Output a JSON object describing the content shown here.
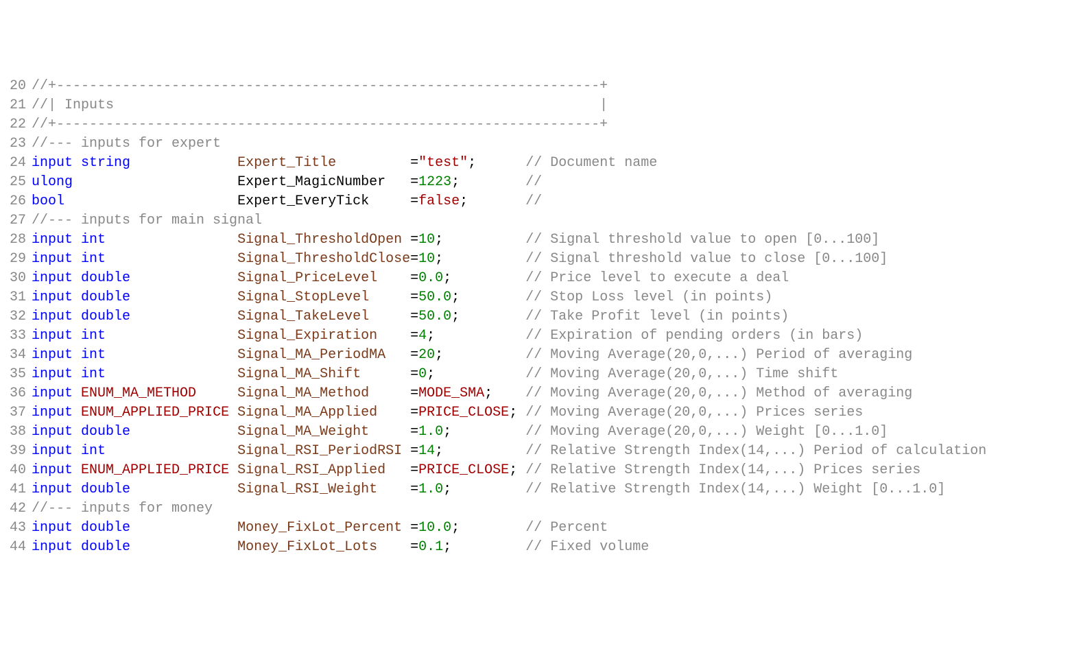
{
  "gutter": {
    "start": 20,
    "end": 44
  },
  "lines": [
    [
      {
        "cls": "tok-comment",
        "text": "//+------------------------------------------------------------------+"
      }
    ],
    [
      {
        "cls": "tok-comment",
        "text": "//| Inputs                                                           |"
      }
    ],
    [
      {
        "cls": "tok-comment",
        "text": "//+------------------------------------------------------------------+"
      }
    ],
    [
      {
        "cls": "tok-comment",
        "text": "//--- inputs for expert"
      }
    ],
    [
      {
        "cls": "tok-keyword",
        "text": "input"
      },
      {
        "cls": "tok-plain",
        "text": " "
      },
      {
        "cls": "tok-keyword",
        "text": "string"
      },
      {
        "cls": "tok-plain",
        "text": "             "
      },
      {
        "cls": "tok-name",
        "text": "Expert_Title"
      },
      {
        "cls": "tok-plain",
        "text": "         ="
      },
      {
        "cls": "tok-string",
        "text": "\"test\""
      },
      {
        "cls": "tok-punct",
        "text": ";"
      },
      {
        "cls": "tok-plain",
        "text": "      "
      },
      {
        "cls": "tok-comment",
        "text": "// Document name"
      }
    ],
    [
      {
        "cls": "tok-keyword",
        "text": "ulong"
      },
      {
        "cls": "tok-plain",
        "text": "                    "
      },
      {
        "cls": "tok-plain",
        "text": "Expert_MagicNumber"
      },
      {
        "cls": "tok-plain",
        "text": "   ="
      },
      {
        "cls": "tok-number",
        "text": "1223"
      },
      {
        "cls": "tok-punct",
        "text": ";"
      },
      {
        "cls": "tok-plain",
        "text": "        "
      },
      {
        "cls": "tok-comment",
        "text": "//"
      }
    ],
    [
      {
        "cls": "tok-keyword",
        "text": "bool"
      },
      {
        "cls": "tok-plain",
        "text": "                     "
      },
      {
        "cls": "tok-plain",
        "text": "Expert_EveryTick"
      },
      {
        "cls": "tok-plain",
        "text": "     ="
      },
      {
        "cls": "tok-const",
        "text": "false"
      },
      {
        "cls": "tok-punct",
        "text": ";"
      },
      {
        "cls": "tok-plain",
        "text": "       "
      },
      {
        "cls": "tok-comment",
        "text": "//"
      }
    ],
    [
      {
        "cls": "tok-comment",
        "text": "//--- inputs for main signal"
      }
    ],
    [
      {
        "cls": "tok-keyword",
        "text": "input"
      },
      {
        "cls": "tok-plain",
        "text": " "
      },
      {
        "cls": "tok-keyword",
        "text": "int"
      },
      {
        "cls": "tok-plain",
        "text": "                "
      },
      {
        "cls": "tok-name",
        "text": "Signal_ThresholdOpen"
      },
      {
        "cls": "tok-plain",
        "text": " ="
      },
      {
        "cls": "tok-number",
        "text": "10"
      },
      {
        "cls": "tok-punct",
        "text": ";"
      },
      {
        "cls": "tok-plain",
        "text": "          "
      },
      {
        "cls": "tok-comment",
        "text": "// Signal threshold value to open [0...100]"
      }
    ],
    [
      {
        "cls": "tok-keyword",
        "text": "input"
      },
      {
        "cls": "tok-plain",
        "text": " "
      },
      {
        "cls": "tok-keyword",
        "text": "int"
      },
      {
        "cls": "tok-plain",
        "text": "                "
      },
      {
        "cls": "tok-name",
        "text": "Signal_ThresholdClose"
      },
      {
        "cls": "tok-plain",
        "text": "="
      },
      {
        "cls": "tok-number",
        "text": "10"
      },
      {
        "cls": "tok-punct",
        "text": ";"
      },
      {
        "cls": "tok-plain",
        "text": "          "
      },
      {
        "cls": "tok-comment",
        "text": "// Signal threshold value to close [0...100]"
      }
    ],
    [
      {
        "cls": "tok-keyword",
        "text": "input"
      },
      {
        "cls": "tok-plain",
        "text": " "
      },
      {
        "cls": "tok-keyword",
        "text": "double"
      },
      {
        "cls": "tok-plain",
        "text": "             "
      },
      {
        "cls": "tok-name",
        "text": "Signal_PriceLevel"
      },
      {
        "cls": "tok-plain",
        "text": "    ="
      },
      {
        "cls": "tok-number",
        "text": "0.0"
      },
      {
        "cls": "tok-punct",
        "text": ";"
      },
      {
        "cls": "tok-plain",
        "text": "         "
      },
      {
        "cls": "tok-comment",
        "text": "// Price level to execute a deal"
      }
    ],
    [
      {
        "cls": "tok-keyword",
        "text": "input"
      },
      {
        "cls": "tok-plain",
        "text": " "
      },
      {
        "cls": "tok-keyword",
        "text": "double"
      },
      {
        "cls": "tok-plain",
        "text": "             "
      },
      {
        "cls": "tok-name",
        "text": "Signal_StopLevel"
      },
      {
        "cls": "tok-plain",
        "text": "     ="
      },
      {
        "cls": "tok-number",
        "text": "50.0"
      },
      {
        "cls": "tok-punct",
        "text": ";"
      },
      {
        "cls": "tok-plain",
        "text": "        "
      },
      {
        "cls": "tok-comment",
        "text": "// Stop Loss level (in points)"
      }
    ],
    [
      {
        "cls": "tok-keyword",
        "text": "input"
      },
      {
        "cls": "tok-plain",
        "text": " "
      },
      {
        "cls": "tok-keyword",
        "text": "double"
      },
      {
        "cls": "tok-plain",
        "text": "             "
      },
      {
        "cls": "tok-name",
        "text": "Signal_TakeLevel"
      },
      {
        "cls": "tok-plain",
        "text": "     ="
      },
      {
        "cls": "tok-number",
        "text": "50.0"
      },
      {
        "cls": "tok-punct",
        "text": ";"
      },
      {
        "cls": "tok-plain",
        "text": "        "
      },
      {
        "cls": "tok-comment",
        "text": "// Take Profit level (in points)"
      }
    ],
    [
      {
        "cls": "tok-keyword",
        "text": "input"
      },
      {
        "cls": "tok-plain",
        "text": " "
      },
      {
        "cls": "tok-keyword",
        "text": "int"
      },
      {
        "cls": "tok-plain",
        "text": "                "
      },
      {
        "cls": "tok-name",
        "text": "Signal_Expiration"
      },
      {
        "cls": "tok-plain",
        "text": "    ="
      },
      {
        "cls": "tok-number",
        "text": "4"
      },
      {
        "cls": "tok-punct",
        "text": ";"
      },
      {
        "cls": "tok-plain",
        "text": "           "
      },
      {
        "cls": "tok-comment",
        "text": "// Expiration of pending orders (in bars)"
      }
    ],
    [
      {
        "cls": "tok-keyword",
        "text": "input"
      },
      {
        "cls": "tok-plain",
        "text": " "
      },
      {
        "cls": "tok-keyword",
        "text": "int"
      },
      {
        "cls": "tok-plain",
        "text": "                "
      },
      {
        "cls": "tok-name",
        "text": "Signal_MA_PeriodMA"
      },
      {
        "cls": "tok-plain",
        "text": "   ="
      },
      {
        "cls": "tok-number",
        "text": "20"
      },
      {
        "cls": "tok-punct",
        "text": ";"
      },
      {
        "cls": "tok-plain",
        "text": "          "
      },
      {
        "cls": "tok-comment",
        "text": "// Moving Average(20,0,...) Period of averaging"
      }
    ],
    [
      {
        "cls": "tok-keyword",
        "text": "input"
      },
      {
        "cls": "tok-plain",
        "text": " "
      },
      {
        "cls": "tok-keyword",
        "text": "int"
      },
      {
        "cls": "tok-plain",
        "text": "                "
      },
      {
        "cls": "tok-name",
        "text": "Signal_MA_Shift"
      },
      {
        "cls": "tok-plain",
        "text": "      ="
      },
      {
        "cls": "tok-number",
        "text": "0"
      },
      {
        "cls": "tok-punct",
        "text": ";"
      },
      {
        "cls": "tok-plain",
        "text": "           "
      },
      {
        "cls": "tok-comment",
        "text": "// Moving Average(20,0,...) Time shift"
      }
    ],
    [
      {
        "cls": "tok-keyword",
        "text": "input"
      },
      {
        "cls": "tok-plain",
        "text": " "
      },
      {
        "cls": "tok-type",
        "text": "ENUM_MA_METHOD"
      },
      {
        "cls": "tok-plain",
        "text": "     "
      },
      {
        "cls": "tok-name",
        "text": "Signal_MA_Method"
      },
      {
        "cls": "tok-plain",
        "text": "     ="
      },
      {
        "cls": "tok-const",
        "text": "MODE_SMA"
      },
      {
        "cls": "tok-punct",
        "text": ";"
      },
      {
        "cls": "tok-plain",
        "text": "    "
      },
      {
        "cls": "tok-comment",
        "text": "// Moving Average(20,0,...) Method of averaging"
      }
    ],
    [
      {
        "cls": "tok-keyword",
        "text": "input"
      },
      {
        "cls": "tok-plain",
        "text": " "
      },
      {
        "cls": "tok-type",
        "text": "ENUM_APPLIED_PRICE"
      },
      {
        "cls": "tok-plain",
        "text": " "
      },
      {
        "cls": "tok-name",
        "text": "Signal_MA_Applied"
      },
      {
        "cls": "tok-plain",
        "text": "    ="
      },
      {
        "cls": "tok-const",
        "text": "PRICE_CLOSE"
      },
      {
        "cls": "tok-punct",
        "text": ";"
      },
      {
        "cls": "tok-plain",
        "text": " "
      },
      {
        "cls": "tok-comment",
        "text": "// Moving Average(20,0,...) Prices series"
      }
    ],
    [
      {
        "cls": "tok-keyword",
        "text": "input"
      },
      {
        "cls": "tok-plain",
        "text": " "
      },
      {
        "cls": "tok-keyword",
        "text": "double"
      },
      {
        "cls": "tok-plain",
        "text": "             "
      },
      {
        "cls": "tok-name",
        "text": "Signal_MA_Weight"
      },
      {
        "cls": "tok-plain",
        "text": "     ="
      },
      {
        "cls": "tok-number",
        "text": "1.0"
      },
      {
        "cls": "tok-punct",
        "text": ";"
      },
      {
        "cls": "tok-plain",
        "text": "         "
      },
      {
        "cls": "tok-comment",
        "text": "// Moving Average(20,0,...) Weight [0...1.0]"
      }
    ],
    [
      {
        "cls": "tok-keyword",
        "text": "input"
      },
      {
        "cls": "tok-plain",
        "text": " "
      },
      {
        "cls": "tok-keyword",
        "text": "int"
      },
      {
        "cls": "tok-plain",
        "text": "                "
      },
      {
        "cls": "tok-name",
        "text": "Signal_RSI_PeriodRSI"
      },
      {
        "cls": "tok-plain",
        "text": " ="
      },
      {
        "cls": "tok-number",
        "text": "14"
      },
      {
        "cls": "tok-punct",
        "text": ";"
      },
      {
        "cls": "tok-plain",
        "text": "          "
      },
      {
        "cls": "tok-comment",
        "text": "// Relative Strength Index(14,...) Period of calculation"
      }
    ],
    [
      {
        "cls": "tok-keyword",
        "text": "input"
      },
      {
        "cls": "tok-plain",
        "text": " "
      },
      {
        "cls": "tok-type",
        "text": "ENUM_APPLIED_PRICE"
      },
      {
        "cls": "tok-plain",
        "text": " "
      },
      {
        "cls": "tok-name",
        "text": "Signal_RSI_Applied"
      },
      {
        "cls": "tok-plain",
        "text": "   ="
      },
      {
        "cls": "tok-const",
        "text": "PRICE_CLOSE"
      },
      {
        "cls": "tok-punct",
        "text": ";"
      },
      {
        "cls": "tok-plain",
        "text": " "
      },
      {
        "cls": "tok-comment",
        "text": "// Relative Strength Index(14,...) Prices series"
      }
    ],
    [
      {
        "cls": "tok-keyword",
        "text": "input"
      },
      {
        "cls": "tok-plain",
        "text": " "
      },
      {
        "cls": "tok-keyword",
        "text": "double"
      },
      {
        "cls": "tok-plain",
        "text": "             "
      },
      {
        "cls": "tok-name",
        "text": "Signal_RSI_Weight"
      },
      {
        "cls": "tok-plain",
        "text": "    ="
      },
      {
        "cls": "tok-number",
        "text": "1.0"
      },
      {
        "cls": "tok-punct",
        "text": ";"
      },
      {
        "cls": "tok-plain",
        "text": "         "
      },
      {
        "cls": "tok-comment",
        "text": "// Relative Strength Index(14,...) Weight [0...1.0]"
      }
    ],
    [
      {
        "cls": "tok-comment",
        "text": "//--- inputs for money"
      }
    ],
    [
      {
        "cls": "tok-keyword",
        "text": "input"
      },
      {
        "cls": "tok-plain",
        "text": " "
      },
      {
        "cls": "tok-keyword",
        "text": "double"
      },
      {
        "cls": "tok-plain",
        "text": "             "
      },
      {
        "cls": "tok-name",
        "text": "Money_FixLot_Percent"
      },
      {
        "cls": "tok-plain",
        "text": " ="
      },
      {
        "cls": "tok-number",
        "text": "10.0"
      },
      {
        "cls": "tok-punct",
        "text": ";"
      },
      {
        "cls": "tok-plain",
        "text": "        "
      },
      {
        "cls": "tok-comment",
        "text": "// Percent"
      }
    ],
    [
      {
        "cls": "tok-keyword",
        "text": "input"
      },
      {
        "cls": "tok-plain",
        "text": " "
      },
      {
        "cls": "tok-keyword",
        "text": "double"
      },
      {
        "cls": "tok-plain",
        "text": "             "
      },
      {
        "cls": "tok-name",
        "text": "Money_FixLot_Lots"
      },
      {
        "cls": "tok-plain",
        "text": "    ="
      },
      {
        "cls": "tok-number",
        "text": "0.1"
      },
      {
        "cls": "tok-punct",
        "text": ";"
      },
      {
        "cls": "tok-plain",
        "text": "         "
      },
      {
        "cls": "tok-comment",
        "text": "// Fixed volume"
      }
    ]
  ]
}
